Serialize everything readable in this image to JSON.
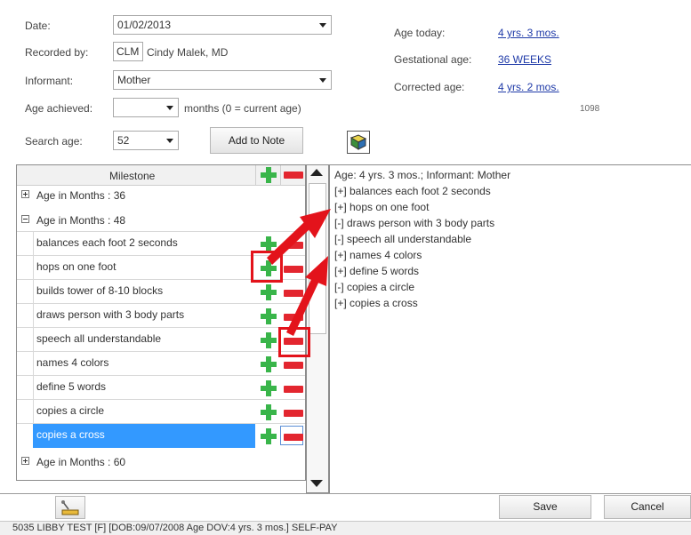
{
  "form": {
    "date_label": "Date:",
    "date_value": "01/02/2013",
    "recorded_by_label": "Recorded by:",
    "recorded_by_code": "CLM",
    "recorded_by_name": "Cindy Malek, MD",
    "informant_label": "Informant:",
    "informant_value": "Mother",
    "age_achieved_label": "Age achieved:",
    "age_achieved_value": "",
    "age_achieved_hint": "months (0 = current age)",
    "search_age_label": "Search age:",
    "search_age_value": "52",
    "add_to_note_label": "Add to Note"
  },
  "ages": {
    "today_label": "Age today:",
    "today_value": "4 yrs. 3 mos.",
    "gestational_label": "Gestational age:",
    "gestational_value": "36 WEEKS",
    "corrected_label": "Corrected age:",
    "corrected_value": "4 yrs. 2 mos.",
    "code": "1098"
  },
  "grid": {
    "header": "Milestone",
    "groups": [
      "Age in Months : 36",
      "Age in Months : 48",
      "Age in Months : 60"
    ],
    "items": [
      "balances each foot 2 seconds",
      "hops on one foot",
      "builds tower of 8-10 blocks",
      "draws person with 3 body parts",
      "speech all understandable",
      "names 4 colors",
      "define 5 words",
      "copies a circle",
      "copies a cross"
    ]
  },
  "note": {
    "lines": [
      "Age: 4 yrs. 3 mos.; Informant: Mother",
      "[+] balances each foot 2 seconds",
      "[+] hops on one foot",
      "[-] draws person with 3 body parts",
      "[-] speech all understandable",
      "[+] names 4 colors",
      "[+] define 5 words",
      "[-] copies a circle",
      "[+] copies a cross"
    ]
  },
  "footer": {
    "save_label": "Save",
    "cancel_label": "Cancel",
    "status": "5035 LIBBY TEST [F] [DOB:09/07/2008  Age DOV:4 yrs. 3 mos.] SELF-PAY"
  },
  "colors": {
    "accent_plus": "#39b54a",
    "accent_minus": "#e3262f",
    "highlight": "#e3131b",
    "selection": "#3399ff"
  }
}
